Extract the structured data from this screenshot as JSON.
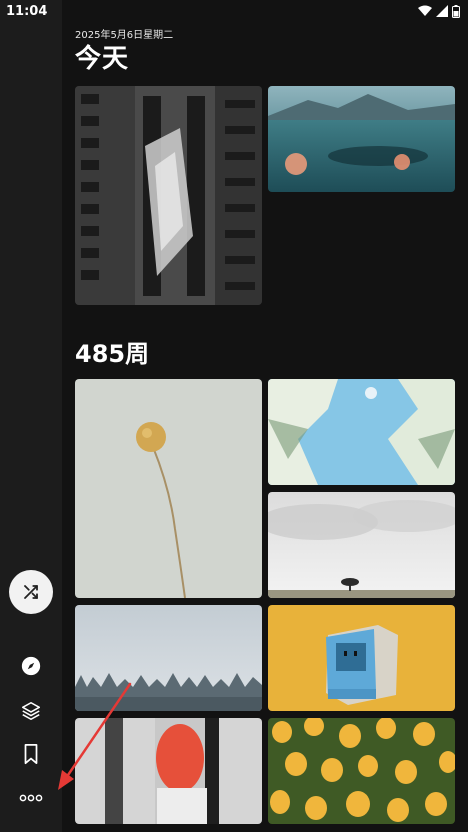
{
  "status_bar": {
    "time": "11:04"
  },
  "today": {
    "date": "2025年5月6日星期二",
    "title": "今天"
  },
  "week": {
    "title": "485周"
  },
  "sidebar": {
    "items": [
      {
        "icon": "shuffle-icon"
      },
      {
        "icon": "compass-icon"
      },
      {
        "icon": "layers-icon"
      },
      {
        "icon": "bookmark-icon"
      },
      {
        "icon": "more-icon"
      }
    ]
  },
  "photos": [
    {
      "section": "today",
      "subject": "building"
    },
    {
      "section": "today",
      "subject": "sea"
    },
    {
      "section": "485",
      "subject": "dandelion"
    },
    {
      "section": "485",
      "subject": "blossom-sky"
    },
    {
      "section": "485",
      "subject": "lone-tree"
    },
    {
      "section": "485",
      "subject": "frost-trees"
    },
    {
      "section": "485",
      "subject": "retro-computer"
    },
    {
      "section": "485",
      "subject": "abstract-glass"
    },
    {
      "section": "485",
      "subject": "tulips"
    }
  ],
  "colors": {
    "annotation_arrow": "#e53935",
    "fab_background": "#f2f2f2"
  }
}
